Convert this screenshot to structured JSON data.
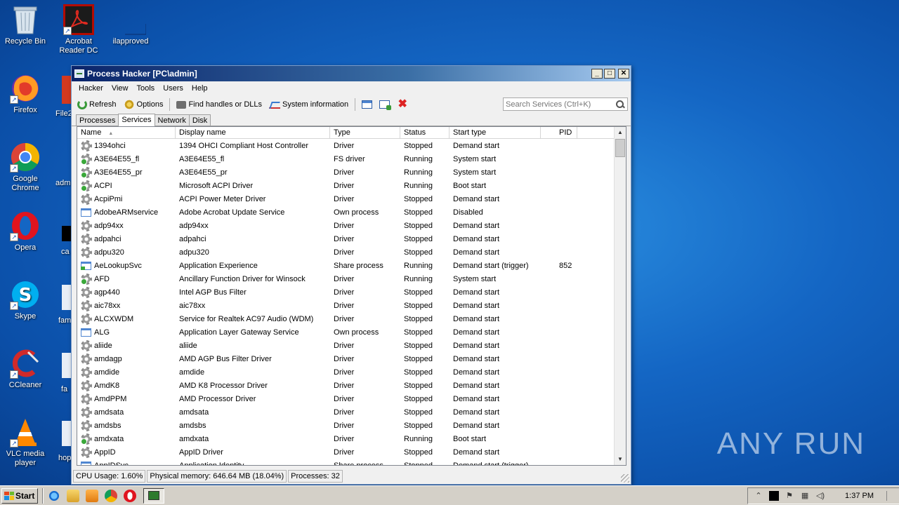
{
  "desktop": {
    "icons": [
      {
        "label": "Recycle Bin"
      },
      {
        "label": "Acrobat Reader DC"
      },
      {
        "label": "ilapproved"
      },
      {
        "label": "Firefox"
      },
      {
        "label": "Google Chrome"
      },
      {
        "label": "Opera"
      },
      {
        "label": "Skype"
      },
      {
        "label": "CCleaner"
      },
      {
        "label": "VLC media player"
      }
    ],
    "partial_labels": [
      "File2",
      "admi",
      "ca",
      "fam",
      "fa",
      "hop"
    ],
    "watermark": "ANY RUN"
  },
  "window": {
    "title": "Process Hacker [PC\\admin]",
    "menu": [
      "Hacker",
      "View",
      "Tools",
      "Users",
      "Help"
    ],
    "toolbar": {
      "refresh": "Refresh",
      "options": "Options",
      "find_handles": "Find handles or DLLs",
      "system_information": "System information"
    },
    "search": {
      "placeholder": "Search Services (Ctrl+K)"
    },
    "tabs": [
      "Processes",
      "Services",
      "Network",
      "Disk"
    ],
    "active_tab": "Services",
    "columns": [
      "Name",
      "Display name",
      "Type",
      "Status",
      "Start type",
      "PID"
    ],
    "rows": [
      {
        "name": "1394ohci",
        "display": "1394 OHCI Compliant Host Controller",
        "type": "Driver",
        "status": "Stopped",
        "start": "Demand start",
        "pid": "",
        "icon": "gear"
      },
      {
        "name": "A3E64E55_fl",
        "display": "A3E64E55_fl",
        "type": "FS driver",
        "status": "Running",
        "start": "System start",
        "pid": "",
        "icon": "gear"
      },
      {
        "name": "A3E64E55_pr",
        "display": "A3E64E55_pr",
        "type": "Driver",
        "status": "Running",
        "start": "System start",
        "pid": "",
        "icon": "gear"
      },
      {
        "name": "ACPI",
        "display": "Microsoft ACPI Driver",
        "type": "Driver",
        "status": "Running",
        "start": "Boot start",
        "pid": "",
        "icon": "gear"
      },
      {
        "name": "AcpiPmi",
        "display": "ACPI Power Meter Driver",
        "type": "Driver",
        "status": "Stopped",
        "start": "Demand start",
        "pid": "",
        "icon": "gear"
      },
      {
        "name": "AdobeARMservice",
        "display": "Adobe Acrobat Update Service",
        "type": "Own process",
        "status": "Stopped",
        "start": "Disabled",
        "pid": "",
        "icon": "win"
      },
      {
        "name": "adp94xx",
        "display": "adp94xx",
        "type": "Driver",
        "status": "Stopped",
        "start": "Demand start",
        "pid": "",
        "icon": "gear"
      },
      {
        "name": "adpahci",
        "display": "adpahci",
        "type": "Driver",
        "status": "Stopped",
        "start": "Demand start",
        "pid": "",
        "icon": "gear"
      },
      {
        "name": "adpu320",
        "display": "adpu320",
        "type": "Driver",
        "status": "Stopped",
        "start": "Demand start",
        "pid": "",
        "icon": "gear"
      },
      {
        "name": "AeLookupSvc",
        "display": "Application Experience",
        "type": "Share process",
        "status": "Running",
        "start": "Demand start (trigger)",
        "pid": "852",
        "icon": "win"
      },
      {
        "name": "AFD",
        "display": "Ancillary Function Driver for Winsock",
        "type": "Driver",
        "status": "Running",
        "start": "System start",
        "pid": "",
        "icon": "gear"
      },
      {
        "name": "agp440",
        "display": "Intel AGP Bus Filter",
        "type": "Driver",
        "status": "Stopped",
        "start": "Demand start",
        "pid": "",
        "icon": "gear"
      },
      {
        "name": "aic78xx",
        "display": "aic78xx",
        "type": "Driver",
        "status": "Stopped",
        "start": "Demand start",
        "pid": "",
        "icon": "gear"
      },
      {
        "name": "ALCXWDM",
        "display": "Service for Realtek AC97 Audio (WDM)",
        "type": "Driver",
        "status": "Stopped",
        "start": "Demand start",
        "pid": "",
        "icon": "gear"
      },
      {
        "name": "ALG",
        "display": "Application Layer Gateway Service",
        "type": "Own process",
        "status": "Stopped",
        "start": "Demand start",
        "pid": "",
        "icon": "win"
      },
      {
        "name": "aliide",
        "display": "aliide",
        "type": "Driver",
        "status": "Stopped",
        "start": "Demand start",
        "pid": "",
        "icon": "gear"
      },
      {
        "name": "amdagp",
        "display": "AMD AGP Bus Filter Driver",
        "type": "Driver",
        "status": "Stopped",
        "start": "Demand start",
        "pid": "",
        "icon": "gear"
      },
      {
        "name": "amdide",
        "display": "amdide",
        "type": "Driver",
        "status": "Stopped",
        "start": "Demand start",
        "pid": "",
        "icon": "gear"
      },
      {
        "name": "AmdK8",
        "display": "AMD K8 Processor Driver",
        "type": "Driver",
        "status": "Stopped",
        "start": "Demand start",
        "pid": "",
        "icon": "gear"
      },
      {
        "name": "AmdPPM",
        "display": "AMD Processor Driver",
        "type": "Driver",
        "status": "Stopped",
        "start": "Demand start",
        "pid": "",
        "icon": "gear"
      },
      {
        "name": "amdsata",
        "display": "amdsata",
        "type": "Driver",
        "status": "Stopped",
        "start": "Demand start",
        "pid": "",
        "icon": "gear"
      },
      {
        "name": "amdsbs",
        "display": "amdsbs",
        "type": "Driver",
        "status": "Stopped",
        "start": "Demand start",
        "pid": "",
        "icon": "gear"
      },
      {
        "name": "amdxata",
        "display": "amdxata",
        "type": "Driver",
        "status": "Running",
        "start": "Boot start",
        "pid": "",
        "icon": "gear"
      },
      {
        "name": "AppID",
        "display": "AppID Driver",
        "type": "Driver",
        "status": "Stopped",
        "start": "Demand start",
        "pid": "",
        "icon": "gear"
      },
      {
        "name": "AppIDSvc",
        "display": "Application Identity",
        "type": "Share process",
        "status": "Stopped",
        "start": "Demand start (trigger)",
        "pid": "",
        "icon": "win"
      }
    ],
    "statusbar": {
      "cpu": "CPU Usage: 1.60%",
      "memory": "Physical memory: 646.64 MB (18.04%)",
      "processes": "Processes: 32"
    }
  },
  "taskbar": {
    "start": "Start",
    "clock": "1:37 PM"
  }
}
